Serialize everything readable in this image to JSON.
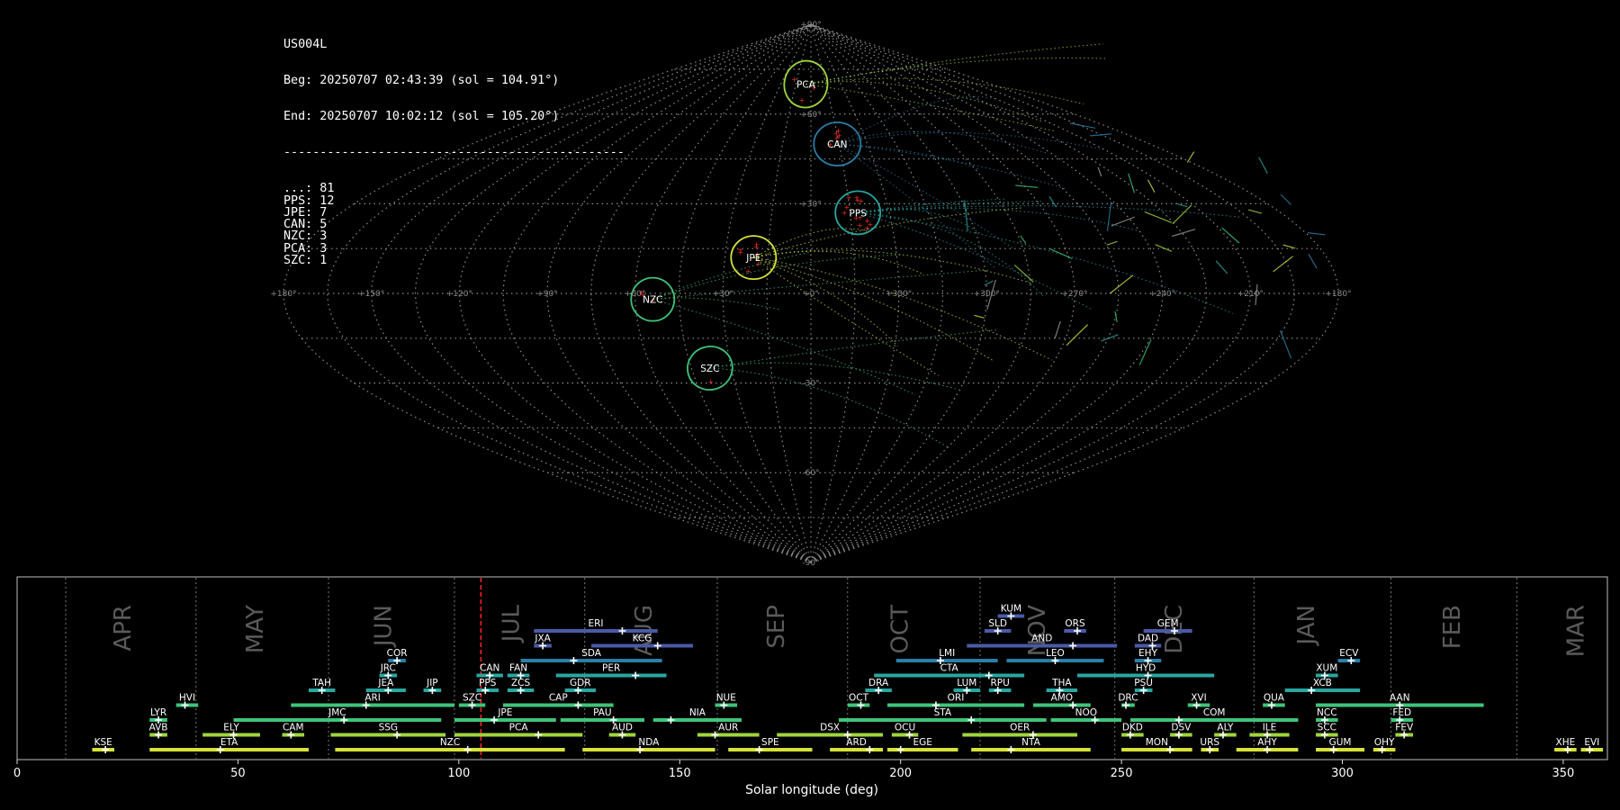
{
  "summary": {
    "station": "US004L",
    "begin": "Beg: 20250707 02:43:39 (sol = 104.91°)",
    "end": "End: 20250707 10:02:12 (sol = 105.20°)",
    "divider": "-----------------------------------------------",
    "counts": [
      {
        "code": "...",
        "n": 81
      },
      {
        "code": "PPS",
        "n": 12
      },
      {
        "code": "JPE",
        "n": 7
      },
      {
        "code": "CAN",
        "n": 5
      },
      {
        "code": "NZC",
        "n": 3
      },
      {
        "code": "PCA",
        "n": 3
      },
      {
        "code": "SZC",
        "n": 1
      }
    ]
  },
  "colors": {
    "background": "#000000",
    "grid": "#8c8c8c",
    "current_sol": "#ff2020",
    "meteor": "#ff2a2a",
    "yellow": "#d6e23a",
    "lime": "#9fd53d",
    "green": "#3fc47a",
    "teal": "#2aa6a0",
    "blue": "#2a7fa8",
    "indigo": "#4a5aa6"
  },
  "skymap": {
    "ra_ticks": [
      "+180°",
      "+150°",
      "+120°",
      "+90°",
      "+60°",
      "+30°",
      "+0°",
      "+330°",
      "+300°",
      "+270°",
      "+240°",
      "+210°",
      "+180°"
    ],
    "dec_ticks": [
      "+90°",
      "+60°",
      "+30°",
      "-30°",
      "-60°",
      "-90°"
    ],
    "radiants": [
      {
        "code": "PCA",
        "lon": -5,
        "lat": 70,
        "rx": 24,
        "ry": 26,
        "rot": 10,
        "color": "lime",
        "hits": 3
      },
      {
        "code": "CAN",
        "lon": 14,
        "lat": 50,
        "rx": 26,
        "ry": 24,
        "rot": 0,
        "color": "blue",
        "hits": 5
      },
      {
        "code": "PPS",
        "lon": 18,
        "lat": 27,
        "rx": 25,
        "ry": 24,
        "rot": 0,
        "color": "teal",
        "hits": 12
      },
      {
        "code": "JPE",
        "lon": -20,
        "lat": 12,
        "rx": 25,
        "ry": 24,
        "rot": 0,
        "color": "yellow",
        "hits": 7
      },
      {
        "code": "NZC",
        "lon": -54,
        "lat": -2,
        "rx": 24,
        "ry": 24,
        "rot": 0,
        "color": "green",
        "hits": 3
      },
      {
        "code": "SZC",
        "lon": -38,
        "lat": -25,
        "rx": 25,
        "ry": 24,
        "rot": -15,
        "color": "green",
        "hits": 1
      }
    ]
  },
  "chart_data": {
    "type": "timeline",
    "xlabel": "Solar longitude (deg)",
    "xlim": [
      0,
      360
    ],
    "x_ticks": [
      0,
      50,
      100,
      150,
      200,
      250,
      300,
      350
    ],
    "current_sol": 105.0,
    "months": [
      {
        "label": "APR",
        "sol": 24
      },
      {
        "label": "MAY",
        "sol": 54
      },
      {
        "label": "JUN",
        "sol": 83
      },
      {
        "label": "JUL",
        "sol": 112
      },
      {
        "label": "AUG",
        "sol": 142
      },
      {
        "label": "SEP",
        "sol": 172
      },
      {
        "label": "OCT",
        "sol": 200
      },
      {
        "label": "NOV",
        "sol": 231
      },
      {
        "label": "DEC",
        "sol": 262
      },
      {
        "label": "JAN",
        "sol": 292
      },
      {
        "label": "FEB",
        "sol": 325
      },
      {
        "label": "MAR",
        "sol": 353
      }
    ],
    "month_boundaries": [
      11,
      40.5,
      70.5,
      99,
      128.5,
      158.5,
      188,
      218,
      248.5,
      280,
      311,
      339.5
    ],
    "showers": [
      {
        "code": "KUM",
        "start": 222,
        "end": 228,
        "peak": 225,
        "row": 9,
        "color": "indigo"
      },
      {
        "code": "ERI",
        "start": 117,
        "end": 145,
        "peak": 137,
        "row": 8,
        "color": "indigo"
      },
      {
        "code": "SLD",
        "start": 219,
        "end": 225,
        "peak": 222,
        "row": 8,
        "color": "indigo"
      },
      {
        "code": "ORS",
        "start": 237,
        "end": 242,
        "peak": 240,
        "row": 8,
        "color": "indigo"
      },
      {
        "code": "GEM",
        "start": 255,
        "end": 266,
        "peak": 262,
        "row": 8,
        "color": "indigo"
      },
      {
        "code": "JXA",
        "start": 117,
        "end": 121,
        "peak": 119,
        "row": 7,
        "color": "indigo"
      },
      {
        "code": "KCG",
        "start": 130,
        "end": 153,
        "peak": 145,
        "row": 7,
        "color": "indigo"
      },
      {
        "code": "AND",
        "start": 215,
        "end": 249,
        "peak": 239,
        "row": 7,
        "color": "indigo"
      },
      {
        "code": "DAD",
        "start": 253,
        "end": 259,
        "peak": 257,
        "row": 7,
        "color": "indigo"
      },
      {
        "code": "COR",
        "start": 84,
        "end": 88,
        "peak": 86,
        "row": 6,
        "color": "blue"
      },
      {
        "code": "SDA",
        "start": 114,
        "end": 146,
        "peak": 126,
        "row": 6,
        "color": "blue"
      },
      {
        "code": "LMI",
        "start": 199,
        "end": 222,
        "peak": 209,
        "row": 6,
        "color": "blue"
      },
      {
        "code": "LEO",
        "start": 224,
        "end": 246,
        "peak": 235,
        "row": 6,
        "color": "blue"
      },
      {
        "code": "EHY",
        "start": 253,
        "end": 259,
        "peak": 256,
        "row": 6,
        "color": "blue"
      },
      {
        "code": "ECV",
        "start": 299,
        "end": 304,
        "peak": 302,
        "row": 6,
        "color": "blue"
      },
      {
        "code": "JRC",
        "start": 82,
        "end": 86,
        "peak": 84,
        "row": 5,
        "color": "teal"
      },
      {
        "code": "CAN",
        "start": 104,
        "end": 110,
        "peak": 107,
        "row": 5,
        "color": "teal"
      },
      {
        "code": "FAN",
        "start": 111,
        "end": 116,
        "peak": 114,
        "row": 5,
        "color": "teal"
      },
      {
        "code": "PER",
        "start": 122,
        "end": 147,
        "peak": 140,
        "row": 5,
        "color": "teal"
      },
      {
        "code": "CTA",
        "start": 194,
        "end": 228,
        "peak": 220,
        "row": 5,
        "color": "teal"
      },
      {
        "code": "HYD",
        "start": 240,
        "end": 271,
        "peak": 256,
        "row": 5,
        "color": "teal"
      },
      {
        "code": "XUM",
        "start": 294,
        "end": 299,
        "peak": 296,
        "row": 5,
        "color": "teal"
      },
      {
        "code": "TAH",
        "start": 66,
        "end": 72,
        "peak": 69,
        "row": 4,
        "color": "teal"
      },
      {
        "code": "JEA",
        "start": 79,
        "end": 88,
        "peak": 84,
        "row": 4,
        "color": "teal"
      },
      {
        "code": "JIP",
        "start": 92,
        "end": 96,
        "peak": 94,
        "row": 4,
        "color": "teal"
      },
      {
        "code": "PPS",
        "start": 104,
        "end": 109,
        "peak": 106,
        "row": 4,
        "color": "teal"
      },
      {
        "code": "ZCS",
        "start": 111,
        "end": 117,
        "peak": 114,
        "row": 4,
        "color": "teal"
      },
      {
        "code": "GDR",
        "start": 124,
        "end": 131,
        "peak": 127,
        "row": 4,
        "color": "teal"
      },
      {
        "code": "DRA",
        "start": 192,
        "end": 198,
        "peak": 195,
        "row": 4,
        "color": "teal"
      },
      {
        "code": "LUM",
        "start": 212,
        "end": 218,
        "peak": 215,
        "row": 4,
        "color": "teal"
      },
      {
        "code": "RPU",
        "start": 220,
        "end": 225,
        "peak": 222,
        "row": 4,
        "color": "teal"
      },
      {
        "code": "THA",
        "start": 233,
        "end": 240,
        "peak": 236,
        "row": 4,
        "color": "teal"
      },
      {
        "code": "PSU",
        "start": 253,
        "end": 257,
        "peak": 255,
        "row": 4,
        "color": "teal"
      },
      {
        "code": "XCB",
        "start": 287,
        "end": 304,
        "peak": 293,
        "row": 4,
        "color": "teal"
      },
      {
        "code": "HVI",
        "start": 36,
        "end": 41,
        "peak": 38,
        "row": 3,
        "color": "green"
      },
      {
        "code": "ARI",
        "start": 62,
        "end": 99,
        "peak": 79,
        "row": 3,
        "color": "green"
      },
      {
        "code": "SZC",
        "start": 100,
        "end": 106,
        "peak": 103,
        "row": 3,
        "color": "green"
      },
      {
        "code": "CAP",
        "start": 110,
        "end": 135,
        "peak": 127,
        "row": 3,
        "color": "green"
      },
      {
        "code": "NUE",
        "start": 158,
        "end": 163,
        "peak": 160,
        "row": 3,
        "color": "green"
      },
      {
        "code": "OCT",
        "start": 188,
        "end": 193,
        "peak": 191,
        "row": 3,
        "color": "green"
      },
      {
        "code": "ORI",
        "start": 197,
        "end": 228,
        "peak": 208,
        "row": 3,
        "color": "green"
      },
      {
        "code": "AMO",
        "start": 230,
        "end": 243,
        "peak": 239,
        "row": 3,
        "color": "green"
      },
      {
        "code": "DRC",
        "start": 250,
        "end": 253,
        "peak": 251,
        "row": 3,
        "color": "green"
      },
      {
        "code": "XVI",
        "start": 265,
        "end": 270,
        "peak": 267,
        "row": 3,
        "color": "green"
      },
      {
        "code": "QUA",
        "start": 282,
        "end": 287,
        "peak": 284,
        "row": 3,
        "color": "green"
      },
      {
        "code": "AAN",
        "start": 294,
        "end": 332,
        "peak": 313,
        "row": 3,
        "color": "green"
      },
      {
        "code": "LYR",
        "start": 30,
        "end": 34,
        "peak": 32,
        "row": 2,
        "color": "green"
      },
      {
        "code": "JMC",
        "start": 49,
        "end": 96,
        "peak": 74,
        "row": 2,
        "color": "green"
      },
      {
        "code": "JPE",
        "start": 99,
        "end": 122,
        "peak": 108,
        "row": 2,
        "color": "green"
      },
      {
        "code": "PAU",
        "start": 123,
        "end": 142,
        "peak": 135,
        "row": 2,
        "color": "green"
      },
      {
        "code": "NIA",
        "start": 144,
        "end": 164,
        "peak": 148,
        "row": 2,
        "color": "green"
      },
      {
        "code": "STA",
        "start": 186,
        "end": 233,
        "peak": 216,
        "row": 2,
        "color": "green"
      },
      {
        "code": "NOO",
        "start": 234,
        "end": 250,
        "peak": 244,
        "row": 2,
        "color": "green"
      },
      {
        "code": "COM",
        "start": 252,
        "end": 290,
        "peak": 263,
        "row": 2,
        "color": "green"
      },
      {
        "code": "NCC",
        "start": 294,
        "end": 299,
        "peak": 296,
        "row": 2,
        "color": "green"
      },
      {
        "code": "FED",
        "start": 311,
        "end": 316,
        "peak": 313,
        "row": 2,
        "color": "green"
      },
      {
        "code": "AVB",
        "start": 30,
        "end": 34,
        "peak": 32,
        "row": 1,
        "color": "lime"
      },
      {
        "code": "ELY",
        "start": 42,
        "end": 55,
        "peak": 49,
        "row": 1,
        "color": "lime"
      },
      {
        "code": "CAM",
        "start": 60,
        "end": 65,
        "peak": 62,
        "row": 1,
        "color": "lime"
      },
      {
        "code": "SSG",
        "start": 71,
        "end": 97,
        "peak": 86,
        "row": 1,
        "color": "lime"
      },
      {
        "code": "PCA",
        "start": 99,
        "end": 128,
        "peak": 118,
        "row": 1,
        "color": "lime"
      },
      {
        "code": "AUD",
        "start": 134,
        "end": 140,
        "peak": 137,
        "row": 1,
        "color": "lime"
      },
      {
        "code": "AUR",
        "start": 154,
        "end": 168,
        "peak": 158,
        "row": 1,
        "color": "lime"
      },
      {
        "code": "DSX",
        "start": 172,
        "end": 196,
        "peak": 188,
        "row": 1,
        "color": "lime"
      },
      {
        "code": "OCU",
        "start": 198,
        "end": 204,
        "peak": 202,
        "row": 1,
        "color": "lime"
      },
      {
        "code": "OER",
        "start": 214,
        "end": 240,
        "peak": 230,
        "row": 1,
        "color": "lime"
      },
      {
        "code": "DKD",
        "start": 250,
        "end": 255,
        "peak": 252,
        "row": 1,
        "color": "lime"
      },
      {
        "code": "DSV",
        "start": 261,
        "end": 266,
        "peak": 263,
        "row": 1,
        "color": "lime"
      },
      {
        "code": "ALY",
        "start": 271,
        "end": 276,
        "peak": 273,
        "row": 1,
        "color": "lime"
      },
      {
        "code": "ILE",
        "start": 279,
        "end": 288,
        "peak": 283,
        "row": 1,
        "color": "lime"
      },
      {
        "code": "SCC",
        "start": 294,
        "end": 299,
        "peak": 296,
        "row": 1,
        "color": "lime"
      },
      {
        "code": "FEV",
        "start": 312,
        "end": 316,
        "peak": 314,
        "row": 1,
        "color": "lime"
      },
      {
        "code": "KSE",
        "start": 17,
        "end": 22,
        "peak": 20,
        "row": 0,
        "color": "yellow"
      },
      {
        "code": "ETA",
        "start": 30,
        "end": 66,
        "peak": 46,
        "row": 0,
        "color": "yellow"
      },
      {
        "code": "NZC",
        "start": 72,
        "end": 124,
        "peak": 102,
        "row": 0,
        "color": "yellow"
      },
      {
        "code": "NDA",
        "start": 128,
        "end": 158,
        "peak": 141,
        "row": 0,
        "color": "yellow"
      },
      {
        "code": "SPE",
        "start": 161,
        "end": 180,
        "peak": 168,
        "row": 0,
        "color": "yellow"
      },
      {
        "code": "ARD",
        "start": 184,
        "end": 196,
        "peak": 193,
        "row": 0,
        "color": "yellow"
      },
      {
        "code": "EGE",
        "start": 197,
        "end": 213,
        "peak": 200,
        "row": 0,
        "color": "yellow"
      },
      {
        "code": "NTA",
        "start": 216,
        "end": 243,
        "peak": 225,
        "row": 0,
        "color": "yellow"
      },
      {
        "code": "MON",
        "start": 250,
        "end": 266,
        "peak": 261,
        "row": 0,
        "color": "yellow"
      },
      {
        "code": "URS",
        "start": 268,
        "end": 272,
        "peak": 270,
        "row": 0,
        "color": "yellow"
      },
      {
        "code": "AHY",
        "start": 276,
        "end": 290,
        "peak": 283,
        "row": 0,
        "color": "yellow"
      },
      {
        "code": "GUM",
        "start": 294,
        "end": 305,
        "peak": 298,
        "row": 0,
        "color": "yellow"
      },
      {
        "code": "OHY",
        "start": 307,
        "end": 312,
        "peak": 309,
        "row": 0,
        "color": "yellow"
      },
      {
        "code": "XHE",
        "start": 348,
        "end": 353,
        "peak": 351,
        "row": 0,
        "color": "yellow"
      },
      {
        "code": "EVI",
        "start": 354,
        "end": 359,
        "peak": 356,
        "row": 0,
        "color": "yellow"
      }
    ]
  }
}
